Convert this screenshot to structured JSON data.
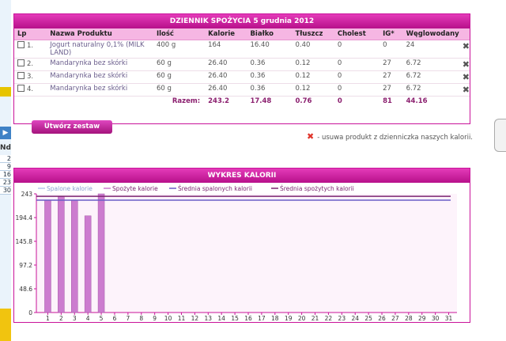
{
  "left_rail": {
    "header": "Nd",
    "days": [
      "2",
      "9",
      "16",
      "23",
      "30"
    ]
  },
  "diary": {
    "title": "DZIENNIK SPOŻYCIA 5 grudnia 2012",
    "columns": [
      "Lp",
      "Nazwa Produktu",
      "Ilość",
      "Kalorie",
      "Białko",
      "Tłuszcz",
      "Cholest",
      "IG*",
      "Węglowodany"
    ],
    "rows": [
      {
        "lp": "1.",
        "name": "Jogurt naturalny 0,1% (MILK LAND)",
        "qty": "400 g",
        "kcal": "164",
        "protein": "16.40",
        "fat": "0.40",
        "chol": "0",
        "ig": "0",
        "carbs": "24"
      },
      {
        "lp": "2.",
        "name": "Mandarynka bez skórki",
        "qty": "60 g",
        "kcal": "26.40",
        "protein": "0.36",
        "fat": "0.12",
        "chol": "0",
        "ig": "27",
        "carbs": "6.72"
      },
      {
        "lp": "3.",
        "name": "Mandarynka bez skórki",
        "qty": "60 g",
        "kcal": "26.40",
        "protein": "0.36",
        "fat": "0.12",
        "chol": "0",
        "ig": "27",
        "carbs": "6.72"
      },
      {
        "lp": "4.",
        "name": "Mandarynka bez skórki",
        "qty": "60 g",
        "kcal": "26.40",
        "protein": "0.36",
        "fat": "0.12",
        "chol": "0",
        "ig": "27",
        "carbs": "6.72"
      }
    ],
    "totals": {
      "label": "Razem:",
      "kcal": "243.2",
      "protein": "17.48",
      "fat": "0.76",
      "chol": "0",
      "ig": "81",
      "carbs": "44.16"
    },
    "create_set_button": "Utwórz zestaw",
    "remove_icon": "x-icon",
    "remove_note": "- usuwa produkt z dzienniczka naszych kalorii."
  },
  "chart_panel_title": "WYKRES KALORII",
  "chart_data": {
    "type": "bar",
    "title": "WYKRES KALORII",
    "categories": [
      "1",
      "2",
      "3",
      "4",
      "5",
      "6",
      "7",
      "8",
      "9",
      "10",
      "11",
      "12",
      "13",
      "14",
      "15",
      "16",
      "17",
      "18",
      "19",
      "20",
      "21",
      "22",
      "23",
      "24",
      "25",
      "26",
      "27",
      "28",
      "29",
      "30",
      "31"
    ],
    "ylim": [
      0,
      243
    ],
    "yticks": [
      "0",
      "48.6",
      "97.2",
      "145.8",
      "194.4",
      "243"
    ],
    "series": [
      {
        "name": "Spalone kalorie",
        "kind": "bar",
        "color": "#b8c8ee",
        "values": [
          0,
          0,
          230,
          0,
          0,
          0,
          0,
          0,
          0,
          0,
          0,
          0,
          0,
          0,
          0,
          0,
          0,
          0,
          0,
          0,
          0,
          0,
          0,
          0,
          0,
          0,
          0,
          0,
          0,
          0,
          0
        ]
      },
      {
        "name": "Spożyte kalorie",
        "kind": "bar",
        "color": "#cc7ccf",
        "values": [
          230,
          237,
          230,
          198,
          243,
          0,
          0,
          0,
          0,
          0,
          0,
          0,
          0,
          0,
          0,
          0,
          0,
          0,
          0,
          0,
          0,
          0,
          0,
          0,
          0,
          0,
          0,
          0,
          0,
          0,
          0
        ]
      },
      {
        "name": "Średnia spalonych kalorii",
        "kind": "line",
        "color": "#6a5cc7",
        "value": 230
      },
      {
        "name": "Średnia spożytych kalorii",
        "kind": "line",
        "color": "#7b2570",
        "value": 238
      }
    ],
    "legend_position": "top-left",
    "grid": false
  }
}
